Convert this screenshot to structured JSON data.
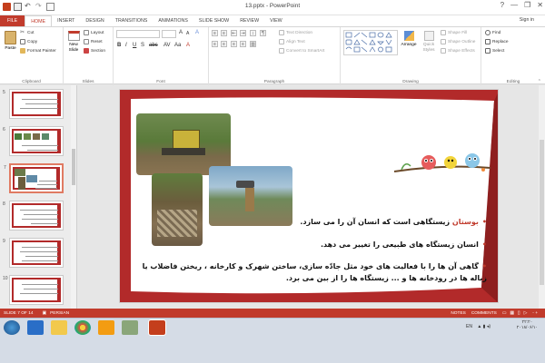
{
  "window": {
    "title": "13.pptx - PowerPoint",
    "controls": [
      "?",
      "—",
      "❐",
      "✕"
    ]
  },
  "tabs": [
    "FILE",
    "HOME",
    "INSERT",
    "DESIGN",
    "TRANSITIONS",
    "ANIMATIONS",
    "SLIDE SHOW",
    "REVIEW",
    "VIEW"
  ],
  "active_tab": "HOME",
  "sign_in": "Sign in",
  "ribbon": {
    "clipboard": {
      "paste": "Paste",
      "cut": "Cut",
      "copy": "Copy",
      "format_painter": "Format Painter",
      "label": "Clipboard"
    },
    "slides": {
      "new_slide": "New Slide",
      "layout": "Layout",
      "reset": "Reset",
      "section": "Section",
      "label": "Slides"
    },
    "font": {
      "label": "Font"
    },
    "paragraph": {
      "text_direction": "Text Direction",
      "align_text": "Align Text",
      "convert_smartart": "Convert to SmartArt",
      "label": "Paragraph"
    },
    "drawing": {
      "arrange": "Arrange",
      "quick_styles": "Quick Styles",
      "shape_fill": "Shape Fill",
      "shape_outline": "Shape Outline",
      "shape_effects": "Shape Effects",
      "label": "Drawing"
    },
    "editing": {
      "find": "Find",
      "replace": "Replace",
      "select": "Select",
      "label": "Editing"
    }
  },
  "thumbnails": [
    {
      "num": "5"
    },
    {
      "num": "6"
    },
    {
      "num": "7",
      "selected": true
    },
    {
      "num": "8"
    },
    {
      "num": "9"
    },
    {
      "num": "10"
    }
  ],
  "slide": {
    "bullets": [
      {
        "highlight": "بوستان",
        "text": " زیستگاهی است که انسان آن را می سازد."
      },
      {
        "highlight": "",
        "text": "انسان زیستگاه های طبیعی را تغییر می دهد."
      },
      {
        "highlight": "",
        "text": "گاهی آن ها را با فعالیت های خود مثل جادّه سازی، ساختن شهرک و کارخانه ، ریختن فاضلاب یا زباله ها در رودخانه ها و ... زیستگاه ها را از بین می برد."
      }
    ]
  },
  "status": {
    "slide": "SLIDE 7 OF 14",
    "language": "PERSIAN",
    "notes": "NOTES",
    "comments": "COMMENTS",
    "zoom": "-  +"
  },
  "taskbar": {
    "lang": "EN",
    "time": "۲۲:۲۰",
    "date": "۲۰۱۸/۰۶/۱۰"
  }
}
